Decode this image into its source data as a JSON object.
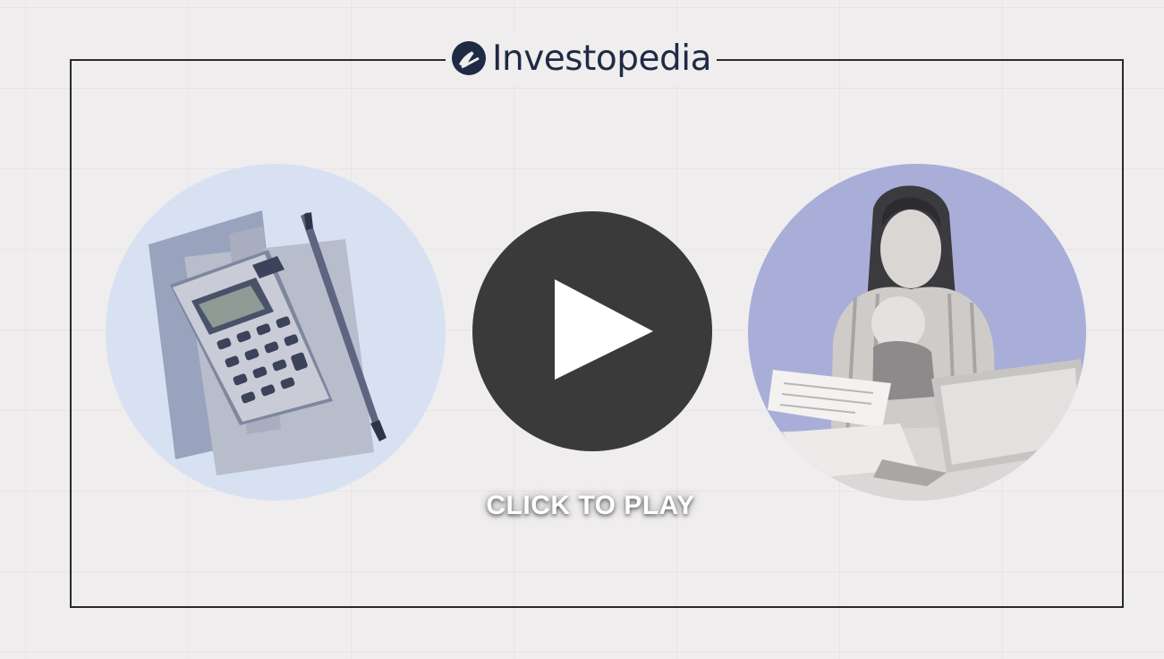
{
  "brand": {
    "name": "Investopedia",
    "mark_icon": "investopedia-logo-icon",
    "color": "#1f2a44"
  },
  "video": {
    "cta_label": "CLICK TO PLAY",
    "play_icon": "play-icon",
    "play_button_color": "#3a3a3a"
  },
  "illustrations": {
    "left": {
      "icon": "calculator-pen-image",
      "bg_color": "#d7e1f1"
    },
    "right": {
      "icon": "woman-with-baby-laptop-image",
      "bg_color": "#a9aed8"
    }
  }
}
